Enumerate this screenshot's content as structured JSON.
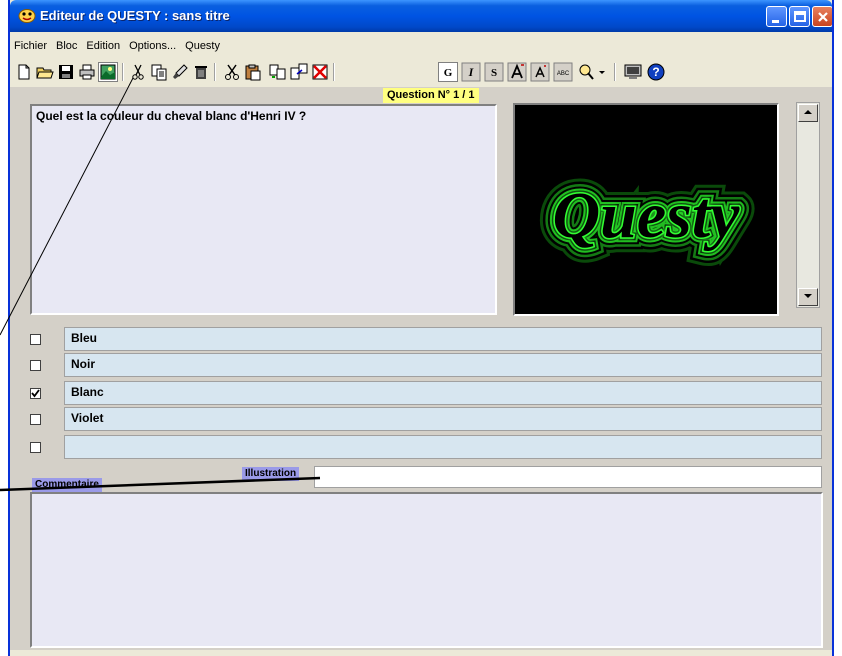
{
  "window": {
    "title": "Editeur de QUESTY : sans titre"
  },
  "menu": [
    "Fichier",
    "Bloc",
    "Edition",
    "Options...",
    "Questy"
  ],
  "toolbar": {
    "text_buttons": {
      "bold": "G",
      "italic": "I",
      "strike": "S",
      "abc": "ABC"
    }
  },
  "question": {
    "number_label": "Question N° 1 / 1",
    "text": "Quel est la couleur du cheval blanc d'Henri IV ?"
  },
  "image_text": "Questy",
  "answers": [
    {
      "text": "Bleu",
      "checked": false
    },
    {
      "text": "Noir",
      "checked": false
    },
    {
      "text": "Blanc",
      "checked": true
    },
    {
      "text": "Violet",
      "checked": false
    },
    {
      "text": "",
      "checked": false
    }
  ],
  "labels": {
    "illustration": "Illustration",
    "commentaire": "Commentaire"
  },
  "colors": {
    "title_bar": "#0054e3",
    "answer_bg": "#d7e6f0",
    "tab_bg": "#9a9ae8",
    "question_number_bg": "#ffff80",
    "glow_green": "#33ff33"
  }
}
